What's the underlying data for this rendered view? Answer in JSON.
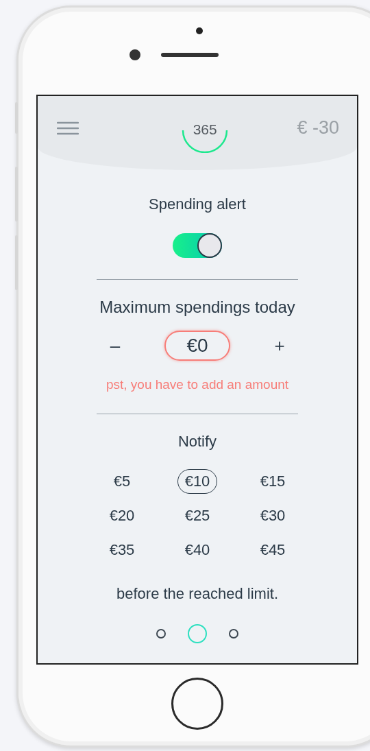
{
  "header": {
    "counter": "365",
    "balance": "€ -30"
  },
  "alert": {
    "label": "Spending alert",
    "on": true
  },
  "limit": {
    "title": "Maximum spendings today",
    "minus": "–",
    "value": "€0",
    "plus": "+",
    "invalid": true,
    "error": "pst, you have to add an amount"
  },
  "notify": {
    "title": "Notify",
    "options": [
      {
        "label": "€5",
        "selected": false
      },
      {
        "label": "€10",
        "selected": true
      },
      {
        "label": "€15",
        "selected": false
      },
      {
        "label": "€20",
        "selected": false
      },
      {
        "label": "€25",
        "selected": false
      },
      {
        "label": "€30",
        "selected": false
      },
      {
        "label": "€35",
        "selected": false
      },
      {
        "label": "€40",
        "selected": false
      },
      {
        "label": "€45",
        "selected": false
      }
    ],
    "footer": "before the reached limit."
  },
  "pager": [
    {
      "selected": false
    },
    {
      "selected": true
    },
    {
      "selected": false
    }
  ]
}
